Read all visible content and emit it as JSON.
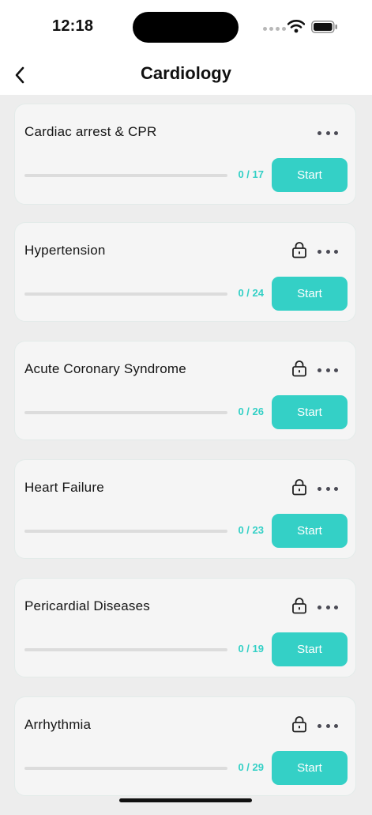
{
  "status_bar": {
    "time": "12:18"
  },
  "header": {
    "title": "Cardiology"
  },
  "topics": [
    {
      "title": "Cardiac arrest & CPR",
      "progress": "0 / 17",
      "completed": 0,
      "total": 17,
      "locked": false,
      "action": "Start"
    },
    {
      "title": "Hypertension",
      "progress": "0 / 24",
      "completed": 0,
      "total": 24,
      "locked": true,
      "action": "Start"
    },
    {
      "title": "Acute Coronary Syndrome",
      "progress": "0 / 26",
      "completed": 0,
      "total": 26,
      "locked": true,
      "action": "Start"
    },
    {
      "title": "Heart Failure",
      "progress": "0 / 23",
      "completed": 0,
      "total": 23,
      "locked": true,
      "action": "Start"
    },
    {
      "title": "Pericardial Diseases",
      "progress": "0 / 19",
      "completed": 0,
      "total": 19,
      "locked": true,
      "action": "Start"
    },
    {
      "title": "Arrhythmia",
      "progress": "0 / 29",
      "completed": 0,
      "total": 29,
      "locked": true,
      "action": "Start"
    }
  ],
  "icons": {
    "back": "chevron-left-icon",
    "more": "more-horizontal-icon",
    "lock": "lock-icon"
  },
  "colors": {
    "accent": "#34d0c6",
    "card_background": "#f5f5f5",
    "page_background": "#ededed"
  }
}
